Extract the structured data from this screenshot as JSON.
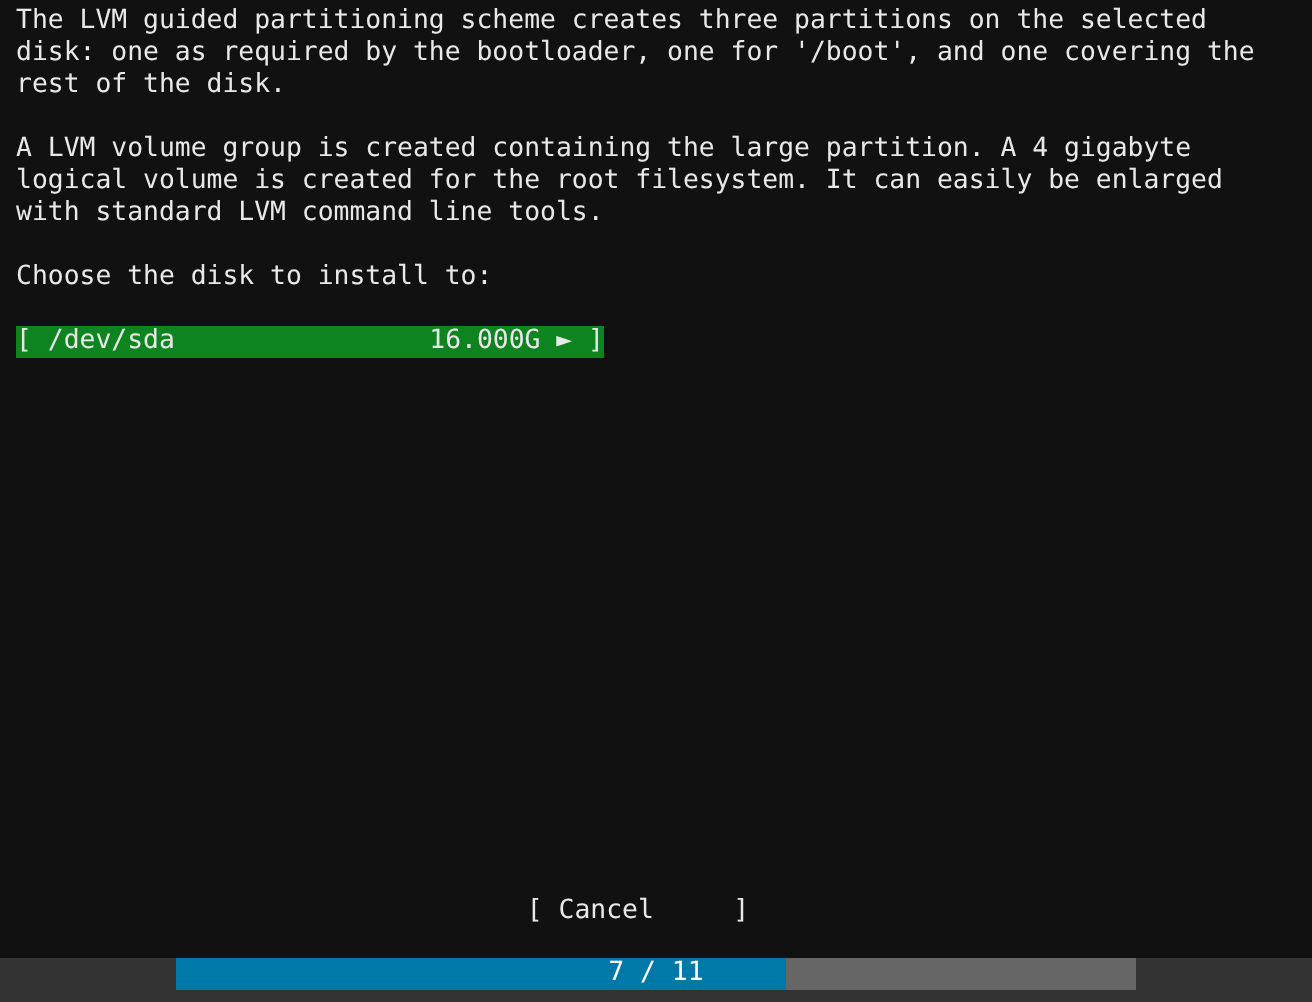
{
  "paragraphs": [
    "The LVM guided partitioning scheme creates three partitions on the selected\ndisk: one as required by the bootloader, one for '/boot', and one covering the\nrest of the disk.",
    "A LVM volume group is created containing the large partition. A 4 gigabyte\nlogical volume is created for the root filesystem. It can easily be enlarged\nwith standard LVM command line tools."
  ],
  "prompt": "Choose the disk to install to:",
  "disks": [
    {
      "left": "[",
      "name": "/dev/sda",
      "size": "16.000G",
      "arrow": "►",
      "right": "]",
      "selected": true
    }
  ],
  "cancel_button": "[ Cancel     ]",
  "progress": {
    "level": 0.636,
    "text": "7 / 11"
  }
}
